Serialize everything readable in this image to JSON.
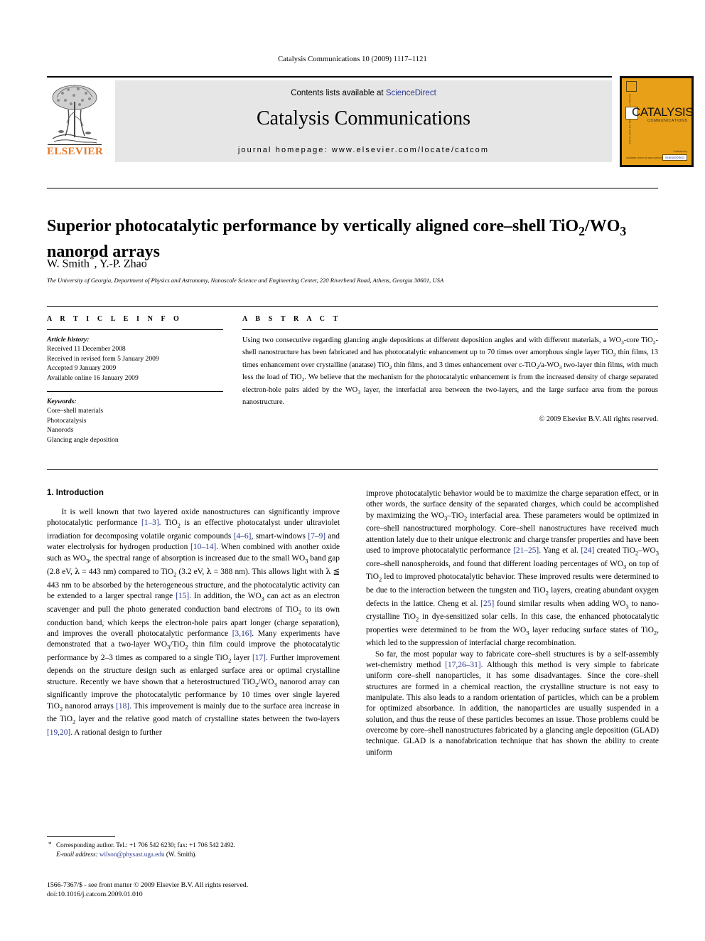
{
  "running_head": "Catalysis Communications 10 (2009) 1117–1121",
  "banner": {
    "contents_prefix": "Contents lists available at ",
    "sciencedirect": "ScienceDirect",
    "journal_name": "Catalysis Communications",
    "homepage": "journal homepage: www.elsevier.com/locate/catcom",
    "publisher_wordmark": "ELSEVIER",
    "publisher_logo_icon": "elsevier-tree-logo",
    "cover": {
      "title": "CATALYSIS",
      "subtitle": "COMMUNICATIONS",
      "spine_text": "CATALYSIS COMMUNICATIONS",
      "footer_left": "Available online at www.sciencedirect.com",
      "footer_right_line": "Published by",
      "sd_badge": "ScienceDirect",
      "accent_color": "#e8a019"
    }
  },
  "article": {
    "title_part1": "Superior photocatalytic performance by vertically aligned core–shell TiO",
    "title_sub1": "2",
    "title_part2": "/WO",
    "title_sub2": "3",
    "title_part3": "nanorod arrays",
    "authors": "W. Smith",
    "author_marker": "*",
    "authors_rest": ", Y.-P. Zhao",
    "affiliation": "The University of Georgia, Department of Physics and Astronomy, Nanoscale Science and Engineering Center, 220 Riverbend Road, Athens, Georgia 30601, USA"
  },
  "info": {
    "heading": "A R T I C L E  I N F O",
    "history_label": "Article history:",
    "history": [
      "Received 11 December 2008",
      "Received in revised form 5 January 2009",
      "Accepted 9 January 2009",
      "Available online 16 January 2009"
    ],
    "keywords_label": "Keywords:",
    "keywords": [
      "Core–shell materials",
      "Photocatalysis",
      "Nanorods",
      "Glancing angle deposition"
    ]
  },
  "abstract": {
    "heading": "A B S T R A C T",
    "copyright": "© 2009 Elsevier B.V. All rights reserved."
  },
  "body": {
    "section_heading": "1. Introduction"
  },
  "footnote": {
    "corresponding": "Corresponding author. Tel.: +1 706 542 6230; fax: +1 706 542 2492.",
    "email_label": "E-mail address:",
    "email": "wilson@physast.uga.edu",
    "email_suffix": "(W. Smith)."
  },
  "footer": {
    "line1": "1566-7367/$ - see front matter © 2009 Elsevier B.V. All rights reserved.",
    "line2": "doi:10.1016/j.catcom.2009.01.010"
  },
  "colors": {
    "link": "#2b3990",
    "elsevier_orange": "#e87722",
    "banner_grey": "#e6e6e6"
  }
}
